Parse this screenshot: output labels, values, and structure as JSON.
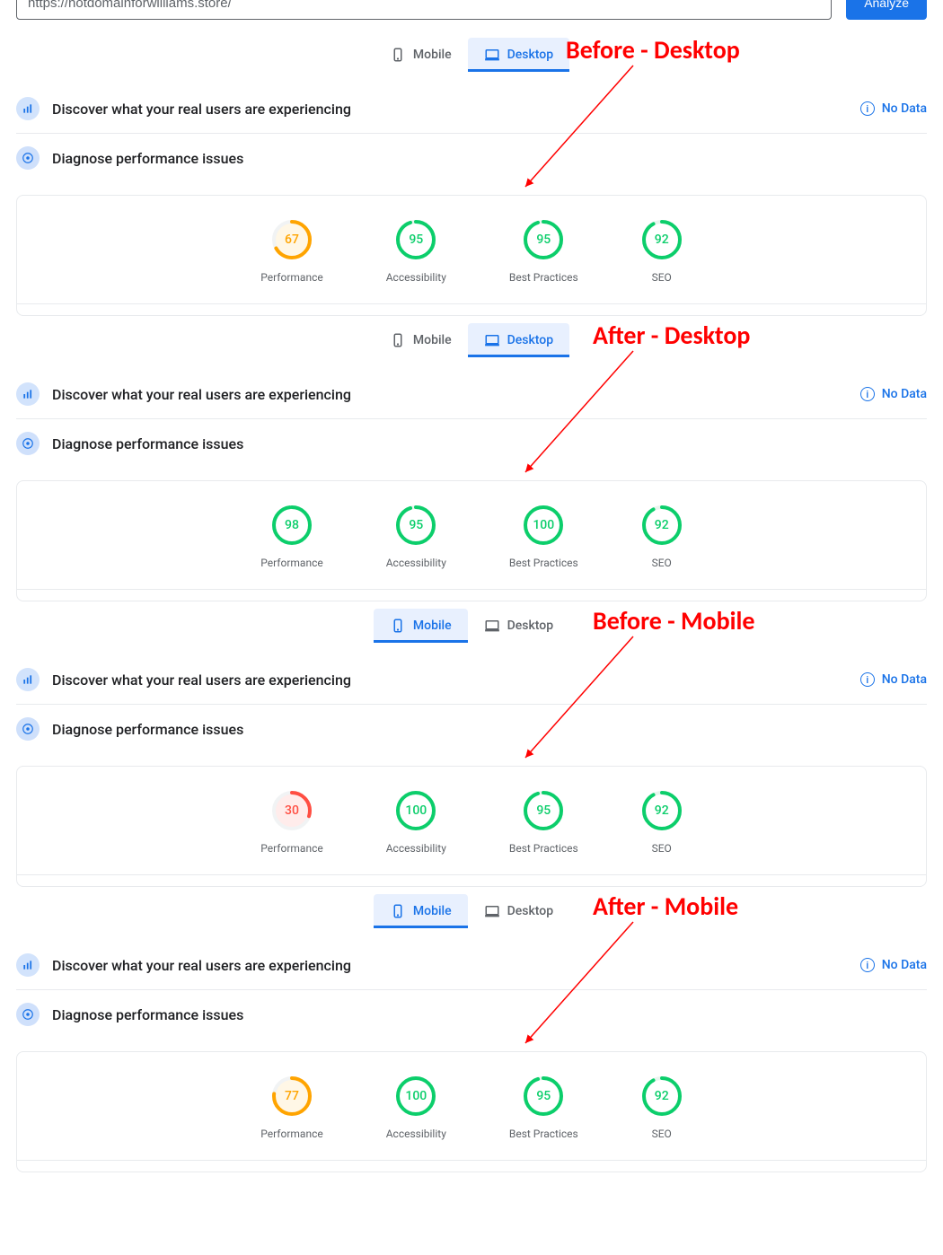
{
  "top": {
    "url": "https://hotdomainforwilliams.store/",
    "analyze": "Analyze"
  },
  "tabs": {
    "mobile": "Mobile",
    "desktop": "Desktop"
  },
  "section_users": "Discover what your real users are experiencing",
  "section_diag": "Diagnose performance issues",
  "no_data": "No Data",
  "labels": {
    "performance": "Performance",
    "accessibility": "Accessibility",
    "best": "Best Practices",
    "seo": "SEO"
  },
  "annot": {
    "before_desktop": "Before - Desktop",
    "after_desktop": "After - Desktop",
    "before_mobile": "Before - Mobile",
    "after_mobile": "After - Mobile"
  },
  "colors": {
    "good": "#0cce6b",
    "good_bg": "#ffffff",
    "avg": "#ffa400",
    "avg_bg": "#fff7e6",
    "bad": "#ff4e42",
    "bad_bg": "#ffeceb",
    "track": "#e8eaed"
  },
  "chart_data": [
    {
      "id": "before_desktop",
      "type": "gauge",
      "title": "Before - Desktop",
      "metrics": [
        {
          "name": "Performance",
          "value": 67,
          "band": "avg"
        },
        {
          "name": "Accessibility",
          "value": 95,
          "band": "good"
        },
        {
          "name": "Best Practices",
          "value": 95,
          "band": "good"
        },
        {
          "name": "SEO",
          "value": 92,
          "band": "good"
        }
      ]
    },
    {
      "id": "after_desktop",
      "type": "gauge",
      "title": "After - Desktop",
      "metrics": [
        {
          "name": "Performance",
          "value": 98,
          "band": "good"
        },
        {
          "name": "Accessibility",
          "value": 95,
          "band": "good"
        },
        {
          "name": "Best Practices",
          "value": 100,
          "band": "good"
        },
        {
          "name": "SEO",
          "value": 92,
          "band": "good"
        }
      ]
    },
    {
      "id": "before_mobile",
      "type": "gauge",
      "title": "Before - Mobile",
      "metrics": [
        {
          "name": "Performance",
          "value": 30,
          "band": "bad"
        },
        {
          "name": "Accessibility",
          "value": 100,
          "band": "good"
        },
        {
          "name": "Best Practices",
          "value": 95,
          "band": "good"
        },
        {
          "name": "SEO",
          "value": 92,
          "band": "good"
        }
      ]
    },
    {
      "id": "after_mobile",
      "type": "gauge",
      "title": "After - Mobile",
      "metrics": [
        {
          "name": "Performance",
          "value": 77,
          "band": "avg"
        },
        {
          "name": "Accessibility",
          "value": 100,
          "band": "good"
        },
        {
          "name": "Best Practices",
          "value": 95,
          "band": "good"
        },
        {
          "name": "SEO",
          "value": 92,
          "band": "good"
        }
      ]
    }
  ]
}
